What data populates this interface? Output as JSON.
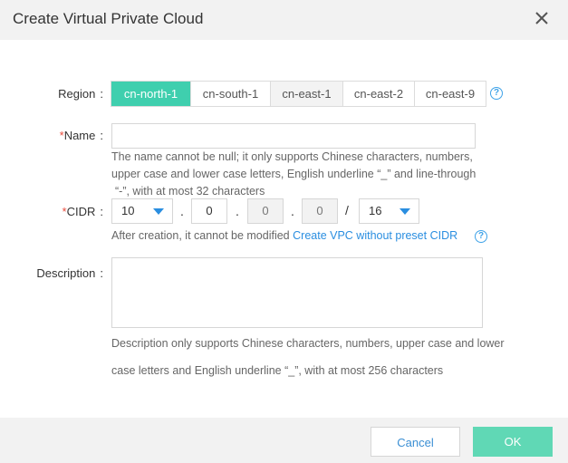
{
  "dialog": {
    "title": "Create Virtual Private Cloud"
  },
  "region": {
    "label": "Region",
    "colon": ":",
    "options": [
      "cn-north-1",
      "cn-south-1",
      "cn-east-1",
      "cn-east-2",
      "cn-east-9"
    ],
    "selected": "cn-north-1",
    "help_icon": "?"
  },
  "name": {
    "required_mark": "*",
    "label": "Name",
    "colon": ":",
    "value": "",
    "hint_line1": "The name cannot be null; it only supports Chinese characters, numbers,",
    "hint_line2": "upper case and lower case letters, English underline “_” and line-through",
    "hint_line3": "“-”, with at most 32 characters"
  },
  "cidr": {
    "required_mark": "*",
    "label": "CIDR",
    "colon": ":",
    "octet1": "10",
    "octet2": "0",
    "octet3": "0",
    "octet4": "0",
    "dot": ".",
    "slash": "/",
    "mask": "16",
    "hint_text": "After creation, it cannot be modified",
    "hint_link": "Create VPC without preset CIDR",
    "help_icon": "?"
  },
  "description": {
    "label": "Description",
    "colon": ":",
    "value": "",
    "hint_line1": "Description only supports Chinese characters, numbers, upper case and lower",
    "hint_line2": "case letters and English underline “_”, with at most 256 characters"
  },
  "footer": {
    "cancel_label": "Cancel",
    "ok_label": "OK"
  },
  "colors": {
    "accent": "#3fcfae",
    "link": "#2a8ee0",
    "required": "#e84c3d"
  }
}
